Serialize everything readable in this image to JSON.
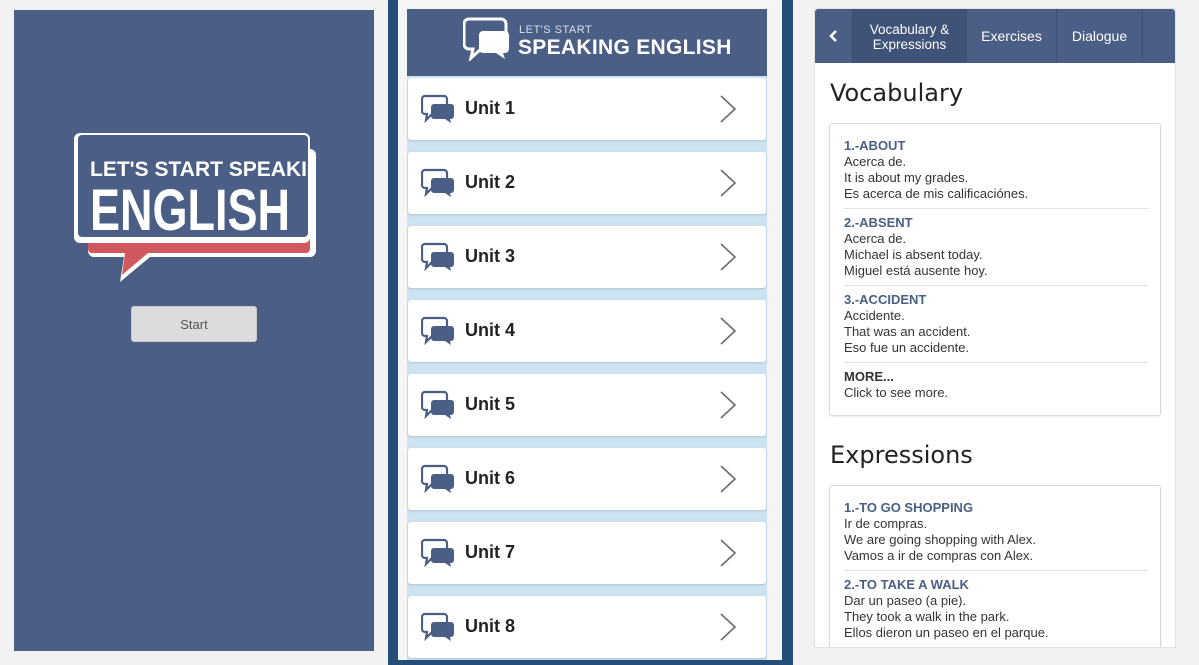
{
  "splash": {
    "logo_line1": "LET'S START SPEAKING",
    "logo_line2": "ENGLISH",
    "start_label": "Start"
  },
  "units": {
    "header_small": "LET'S START",
    "header_big": "SPEAKING ENGLISH",
    "items": [
      {
        "label": "Unit 1"
      },
      {
        "label": "Unit 2"
      },
      {
        "label": "Unit 3"
      },
      {
        "label": "Unit 4"
      },
      {
        "label": "Unit 5"
      },
      {
        "label": "Unit 6"
      },
      {
        "label": "Unit 7"
      },
      {
        "label": "Unit 8"
      }
    ]
  },
  "vocab": {
    "tabs": {
      "back_icon": "chevron-left-icon",
      "vocab_line1": "Vocabulary &",
      "vocab_line2": "Expressions",
      "exercises": "Exercises",
      "dialogue": "Dialogue"
    },
    "vocabulary_title": "Vocabulary",
    "vocabulary": [
      {
        "term": "1.-ABOUT",
        "lines": [
          "Acerca de.",
          "It is about my grades.",
          "Es acerca de mis calificaciónes."
        ]
      },
      {
        "term": "2.-ABSENT",
        "lines": [
          "Acerca de.",
          "Michael is absent today.",
          "Miguel está ausente hoy."
        ]
      },
      {
        "term": "3.-ACCIDENT",
        "lines": [
          "Accidente.",
          "That was an accident.",
          "Eso fue un accidente."
        ]
      },
      {
        "term": "MORE...",
        "lines": [
          "Click to see more."
        ]
      }
    ],
    "expressions_title": "Expressions",
    "expressions": [
      {
        "term": "1.-TO GO SHOPPING",
        "lines": [
          "Ir de compras.",
          "We are going shopping with Alex.",
          "Vamos a ir de compras con Alex."
        ]
      },
      {
        "term": "2.-TO TAKE A WALK",
        "lines": [
          "Dar un paseo (a pie).",
          "They took a walk in the park.",
          "Ellos dieron un paseo en el parque."
        ]
      }
    ]
  },
  "colors": {
    "brand_blue": "#4a5e86",
    "accent_red": "#d0585e",
    "frame_blue": "#244e78",
    "list_bg": "#cde3f2"
  }
}
